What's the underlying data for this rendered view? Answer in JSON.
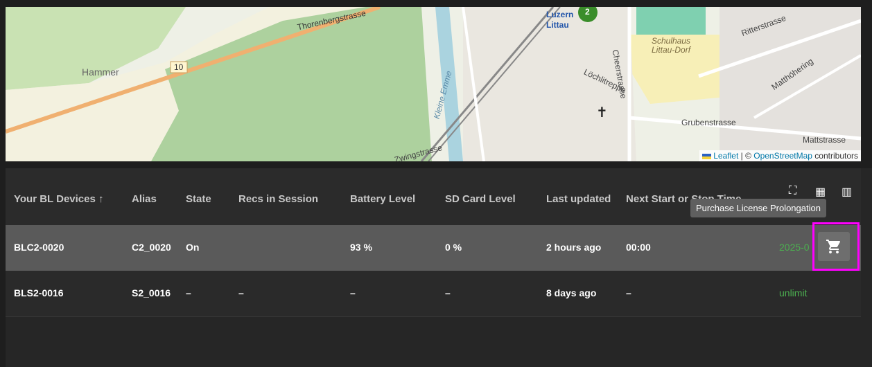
{
  "map": {
    "labels": {
      "hammer": "Hammer",
      "route_number": "10",
      "thorenberg": "Thorenbergstrasse",
      "luzern": "Luzern",
      "littau": "Littau",
      "cluster_count": "2",
      "schulhaus": "Schulhaus",
      "littau_dorf": "Littau-Dorf",
      "cheerstrasse": "Cheerstrasse",
      "lochlitreppe": "Löchlitreppe",
      "grubenstrasse": "Grubenstrasse",
      "ritterstrasse": "Ritterstrasse",
      "matthoehering": "Matthöhering",
      "mattstrasse": "Mattstrasse",
      "kleine_emme": "Kleine Emme",
      "zwingstrasse": "Zwingstrasse"
    },
    "attribution": {
      "leaflet": "Leaflet",
      "separator": " | © ",
      "osm": "OpenStreetMap",
      "contributors": " contributors"
    }
  },
  "table": {
    "headers": {
      "device": "Your BL Devices ↑",
      "alias": "Alias",
      "state": "State",
      "recs": "Recs in Session",
      "battery": "Battery Level",
      "sd": "SD Card Level",
      "updated": "Last updated",
      "next": "Next Start or Stop Time"
    },
    "header_icons": [
      "fullscreen-icon",
      "density-icon",
      "columns-icon"
    ],
    "rows": [
      {
        "device": "BLC2-0020",
        "alias": "C2_0020",
        "state": "On",
        "recs": "",
        "battery": "93 %",
        "sd": "0 %",
        "updated": "2 hours ago",
        "next": "00:00",
        "license": "2025-0"
      },
      {
        "device": "BLS2-0016",
        "alias": "S2_0016",
        "state": "–",
        "recs": "–",
        "battery": "–",
        "sd": "–",
        "updated": "8 days ago",
        "next": "–",
        "license": "unlimit"
      }
    ],
    "tooltip": "Purchase License Prolongation"
  },
  "colors": {
    "accent_green": "#4caf50",
    "highlight": "#ff00ff"
  }
}
